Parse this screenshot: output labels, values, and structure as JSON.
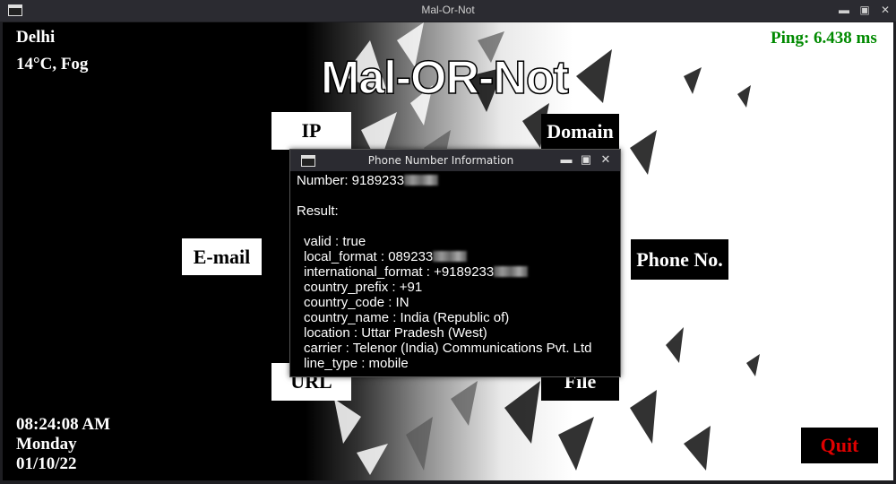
{
  "window": {
    "title": "Mal-Or-Not"
  },
  "app": {
    "title": "Mal-OR-Not",
    "weather": {
      "city": "Delhi",
      "condition": "14°C, Fog"
    },
    "ping": "Ping: 6.438 ms",
    "clock": {
      "time": "08:24:08 AM",
      "day": "Monday",
      "date": "01/10/22"
    },
    "buttons": {
      "ip": "IP",
      "domain": "Domain",
      "email": "E-mail",
      "phone": "Phone No.",
      "url": "URL",
      "file": "File",
      "quit": "Quit"
    }
  },
  "dialog": {
    "title": "Phone Number Information",
    "number_label": "Number: 9189233",
    "result_label": "Result:",
    "fields": {
      "valid": "valid : true",
      "local_format": "local_format : 089233",
      "international_format": "international_format : +9189233",
      "country_prefix": "country_prefix : +91",
      "country_code": "country_code : IN",
      "country_name": "country_name : India (Republic of)",
      "location": "location : Uttar Pradesh (West)",
      "carrier": "carrier : Telenor (India) Communications Pvt. Ltd",
      "line_type": "line_type : mobile"
    }
  },
  "colors": {
    "ping": "#008a00",
    "quit": "#e00000",
    "titlebar": "#2b2b31"
  },
  "icons": {
    "window": "window-icon",
    "minimize": "minimize-icon",
    "maximize": "maximize-icon",
    "close": "close-icon"
  }
}
